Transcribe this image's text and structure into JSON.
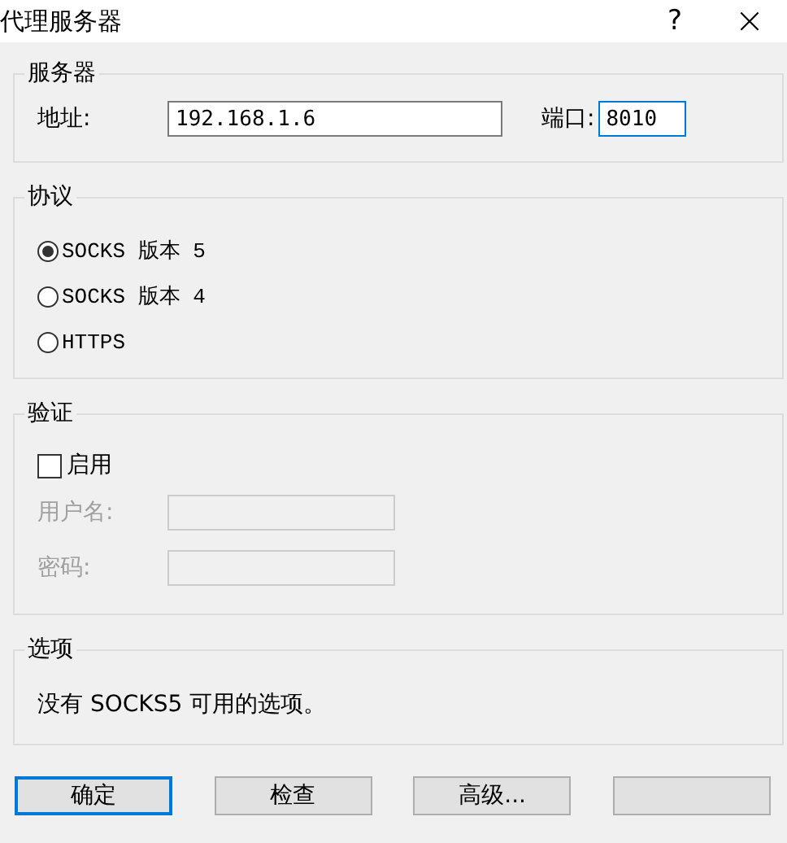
{
  "window": {
    "title": "代理服务器",
    "help": "?",
    "close": "×"
  },
  "server": {
    "legend": "服务器",
    "address_label": "地址:",
    "address_value": "192.168.1.6",
    "port_label": "端口:",
    "port_value": "8010",
    "port_focused": true
  },
  "protocol": {
    "legend": "协议",
    "options": [
      {
        "label": "SOCKS 版本 5",
        "selected": true
      },
      {
        "label": "SOCKS 版本 4",
        "selected": false
      },
      {
        "label": "HTTPS",
        "selected": false
      }
    ]
  },
  "auth": {
    "legend": "验证",
    "enable_label": "启用",
    "checked": false,
    "fields": [
      {
        "label": "用户名:",
        "disabled": true
      },
      {
        "label": "密码:",
        "disabled": true
      }
    ]
  },
  "options": {
    "legend": "选项",
    "text": "没有 SOCKS5 可用的选项。"
  },
  "buttons": [
    {
      "label": "确定",
      "default": true
    },
    {
      "label": "检查",
      "default": false
    },
    {
      "label": "高级...",
      "default": false
    },
    {
      "default": false
    }
  ]
}
